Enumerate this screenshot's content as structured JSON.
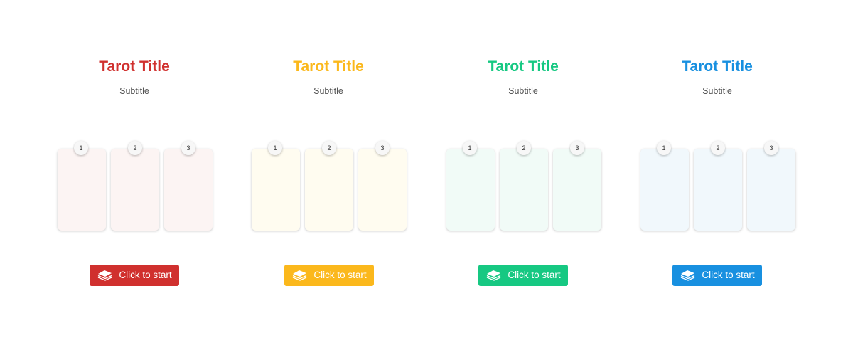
{
  "top_text": "",
  "panels": [
    {
      "title": "Tarot Title",
      "subtitle": "Subtitle",
      "accent": "#d0302e",
      "card_tint": "#fcf4f3",
      "cards": [
        {
          "number": "1"
        },
        {
          "number": "2"
        },
        {
          "number": "3"
        }
      ],
      "button": {
        "label": "Click to start",
        "icon": "cards-icon"
      }
    },
    {
      "title": "Tarot Title",
      "subtitle": "Subtitle",
      "accent": "#fbb81c",
      "card_tint": "#fffcf0",
      "cards": [
        {
          "number": "1"
        },
        {
          "number": "2"
        },
        {
          "number": "3"
        }
      ],
      "button": {
        "label": "Click to start",
        "icon": "cards-icon"
      }
    },
    {
      "title": "Tarot Title",
      "subtitle": "Subtitle",
      "accent": "#16c882",
      "card_tint": "#f1fbf7",
      "cards": [
        {
          "number": "1"
        },
        {
          "number": "2"
        },
        {
          "number": "3"
        }
      ],
      "button": {
        "label": "Click to start",
        "icon": "cards-icon"
      }
    },
    {
      "title": "Tarot Title",
      "subtitle": "Subtitle",
      "accent": "#1890e0",
      "card_tint": "#f1f8fc",
      "cards": [
        {
          "number": "1"
        },
        {
          "number": "2"
        },
        {
          "number": "3"
        }
      ],
      "button": {
        "label": "Click to start",
        "icon": "cards-icon"
      }
    }
  ]
}
